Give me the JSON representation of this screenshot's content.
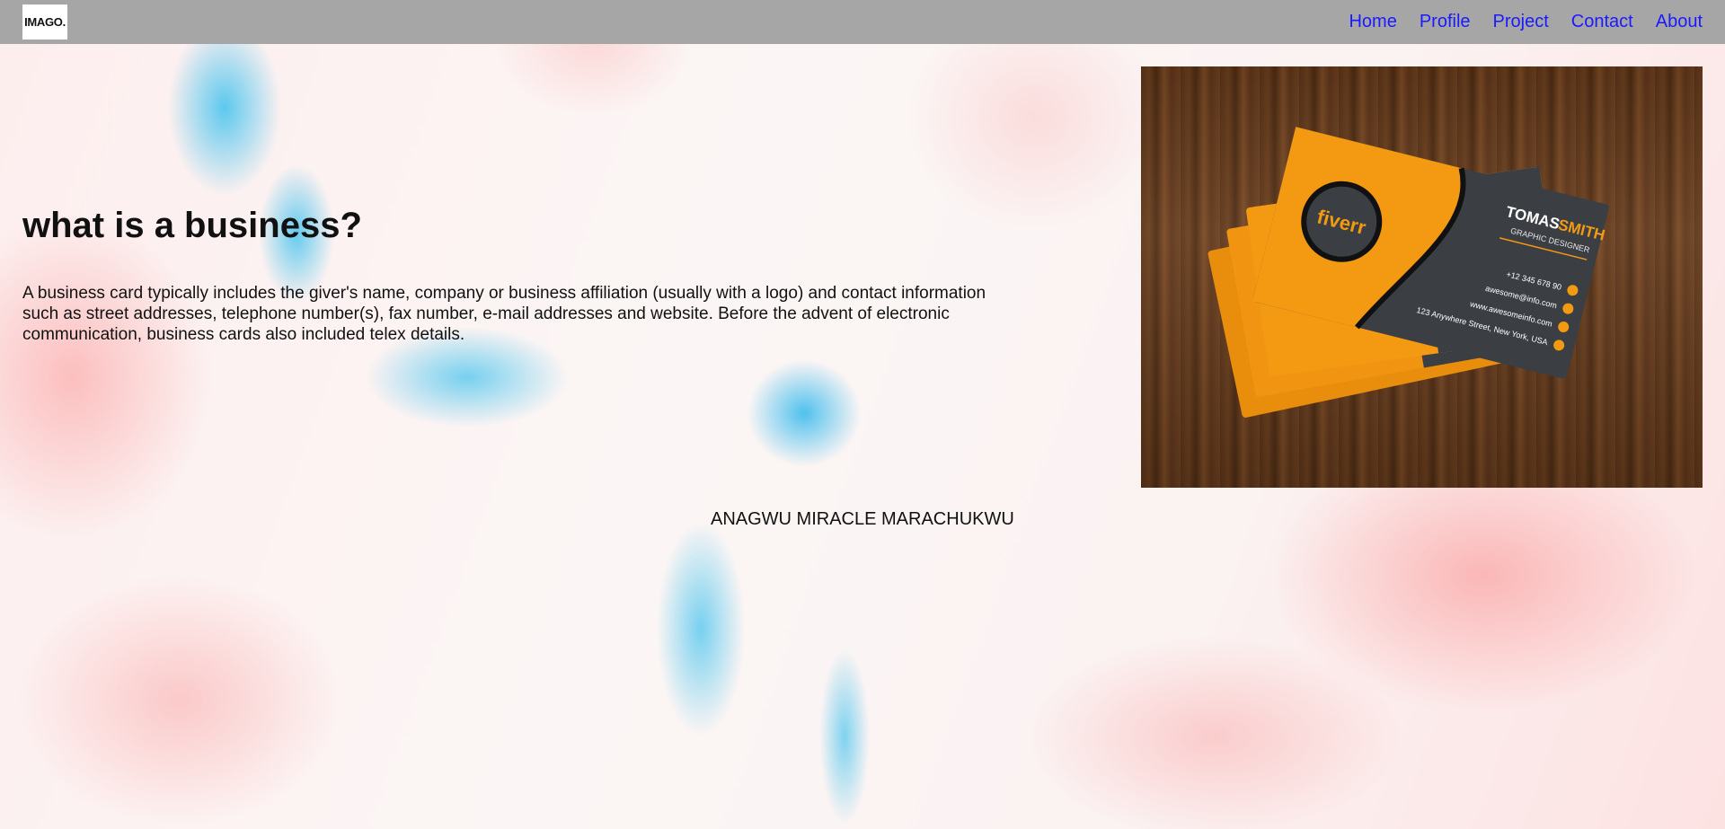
{
  "header": {
    "logo_text": "IMAGO.",
    "nav": [
      {
        "label": "Home"
      },
      {
        "label": "Profile"
      },
      {
        "label": "Project"
      },
      {
        "label": "Contact"
      },
      {
        "label": "About"
      }
    ],
    "colors": {
      "bar": "#a6a6a6",
      "link": "#1a1aff"
    }
  },
  "main": {
    "heading": "what is a business?",
    "paragraph": "A business card typically includes the giver's name, company or business affiliation (usually with a logo) and contact information such as street addresses, telephone number(s), fax number, e-mail addresses and website. Before the advent of electronic communication, business cards also included telex details.",
    "author": "ANAGWU MIRACLE MARACHUKWU"
  },
  "card_image": {
    "brand": "fiverr",
    "name_first": "TOMAS",
    "name_last": "SMITH",
    "title": "GRAPHIC DESIGNER",
    "phone": "+12 345 678 90",
    "email": "awesome@info.com",
    "website": "www.awesomeinfo.com",
    "address": "123 Anywhere Street, New York, USA",
    "colors": {
      "orange": "#f39a12",
      "dark": "#3b3f44",
      "wood": "#5a3418"
    }
  }
}
